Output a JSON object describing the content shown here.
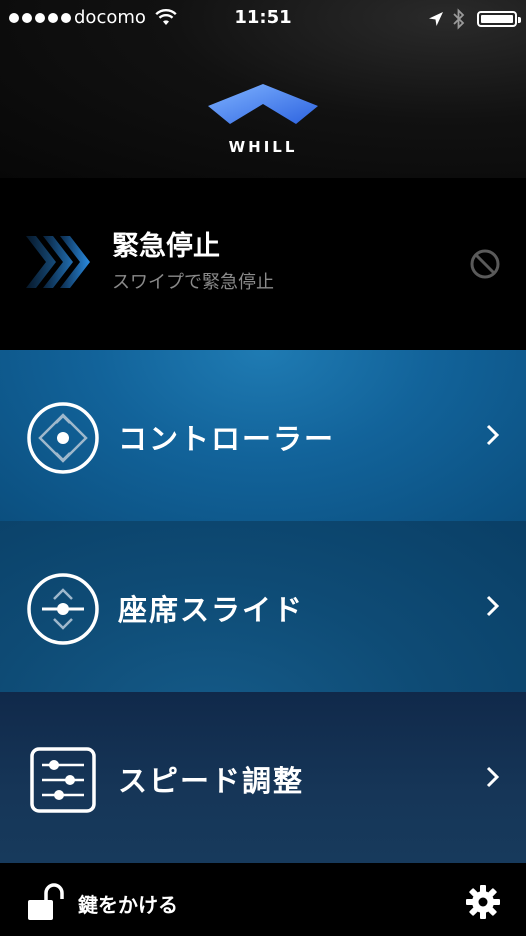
{
  "status_bar": {
    "carrier": "docomo",
    "time": "11:51",
    "signal_dots": 5
  },
  "header": {
    "brand": "WHILL",
    "accent_color": "#4a8cff"
  },
  "emergency": {
    "title": "緊急停止",
    "subtitle": "スワイプで緊急停止"
  },
  "menu": [
    {
      "label": "コントローラー",
      "icon": "controller-icon"
    },
    {
      "label": "座席スライド",
      "icon": "seat-slide-icon"
    },
    {
      "label": "スピード調整",
      "icon": "speed-adjust-icon"
    }
  ],
  "bottom_bar": {
    "lock_label": "鍵をかける",
    "lock_icon": "unlocked-padlock-icon",
    "settings_icon": "gear-icon"
  }
}
